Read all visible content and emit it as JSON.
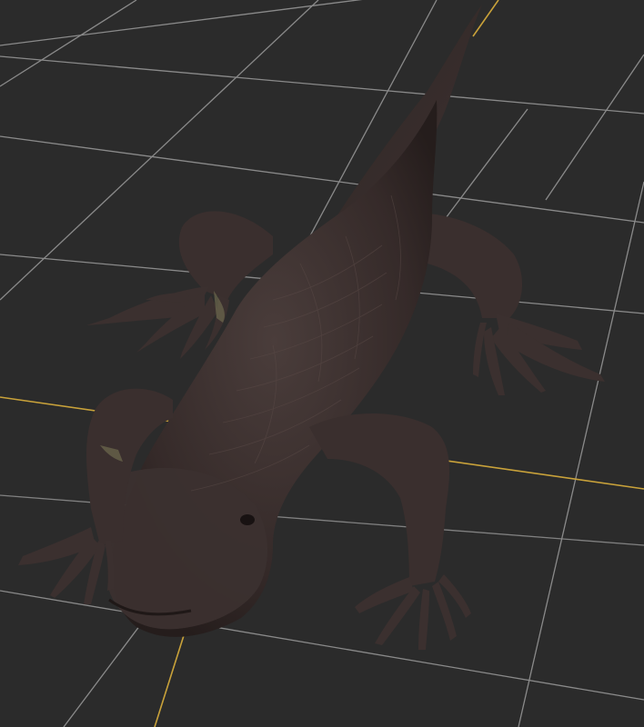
{
  "viewport": {
    "background": "#2b2b2b",
    "grid_color": "#a8a8a8",
    "axis_color": "#c9a23a"
  },
  "model": {
    "icon": "lizard-icon",
    "skin_color": "#3a2f2e",
    "skin_highlight": "#5a4a47",
    "belly_color": "#6d6a4f"
  }
}
